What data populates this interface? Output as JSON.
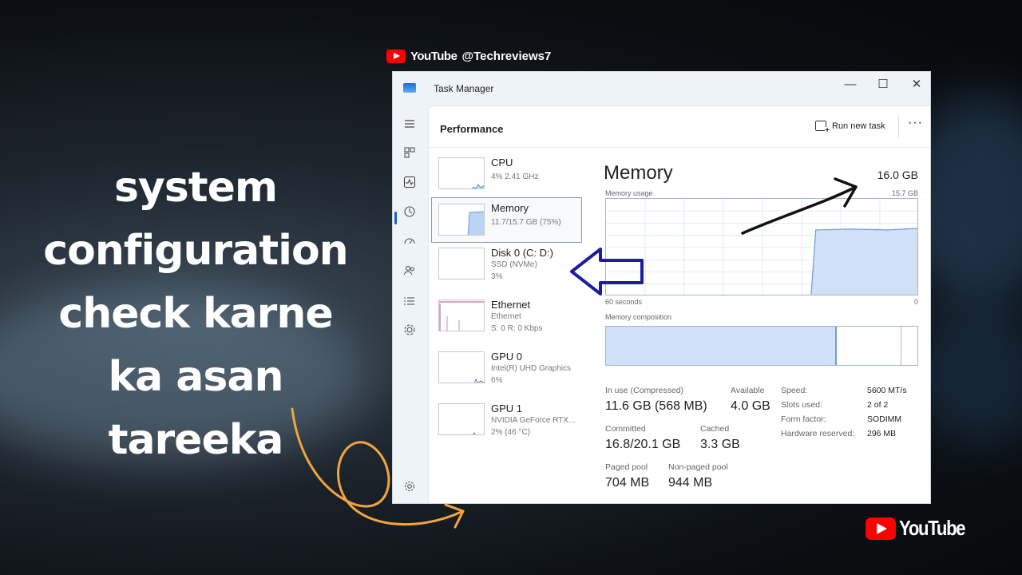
{
  "watermark": {
    "brand": "YouTube",
    "handle": "@Techreviews7"
  },
  "caption": [
    "system",
    "configuration",
    "check karne",
    "ka asan",
    "tareeka"
  ],
  "window": {
    "title": "Task Manager",
    "controls": {
      "minimize": "—",
      "maximize": "☐",
      "close": "✕"
    }
  },
  "nav_icons": [
    "hamburger-icon",
    "processes-icon",
    "performance-icon",
    "app-history-icon",
    "startup-apps-icon",
    "users-icon",
    "details-icon",
    "services-icon",
    "settings-icon"
  ],
  "header": {
    "section": "Performance",
    "run_new_task": "Run new task",
    "more": "···"
  },
  "perf_list": [
    {
      "name": "CPU",
      "sub1": "4% 2.41 GHz",
      "sub2": "",
      "graph_color": "#2e86c1"
    },
    {
      "name": "Memory",
      "sub1": "11.7/15.7 GB (75%)",
      "sub2": "",
      "graph_color": "#6e9bd8",
      "fill": 0.75
    },
    {
      "name": "Disk 0 (C: D:)",
      "sub1": "SSD (NVMe)",
      "sub2": "3%",
      "graph_color": "#5a9e36"
    },
    {
      "name": "Ethernet",
      "sub1": "Ethernet",
      "sub2": "S: 0 R: 0 Kbps",
      "graph_color": "#b5467a"
    },
    {
      "name": "GPU 0",
      "sub1": "Intel(R) UHD Graphics",
      "sub2": "6%",
      "graph_color": "#7a3fb5"
    },
    {
      "name": "GPU 1",
      "sub1": "NVIDIA GeForce RTX...",
      "sub2": "2% (46 °C)",
      "graph_color": "#7a3fb5"
    }
  ],
  "memory": {
    "title": "Memory",
    "total": "16.0 GB",
    "usage_label": "Memory usage",
    "usage_max": "15.7 GB",
    "x_left": "60 seconds",
    "x_right": "0",
    "composition_label": "Memory composition",
    "stats": {
      "in_use_label": "In use (Compressed)",
      "in_use": "11.6 GB (568 MB)",
      "available_label": "Available",
      "available": "4.0 GB",
      "committed_label": "Committed",
      "committed": "16.8/20.1 GB",
      "cached_label": "Cached",
      "cached": "3.3 GB",
      "paged_label": "Paged pool",
      "paged": "704 MB",
      "nonpaged_label": "Non-paged pool",
      "nonpaged": "944 MB"
    },
    "specs": [
      {
        "label": "Speed:",
        "value": "5600 MT/s"
      },
      {
        "label": "Slots used:",
        "value": "2 of 2"
      },
      {
        "label": "Form factor:",
        "value": "SODIMM"
      },
      {
        "label": "Hardware reserved:",
        "value": "296 MB"
      }
    ],
    "usage_fraction": 0.75,
    "composition": {
      "in_use": 0.74,
      "standby": 0.21
    }
  },
  "colors": {
    "accent": "#1f5fbf",
    "memory_fill": "#cfe0f7",
    "memory_line": "#6e9bd8",
    "annotation_blue": "#1b1f9e",
    "annotation_orange": "#f2a53a"
  }
}
